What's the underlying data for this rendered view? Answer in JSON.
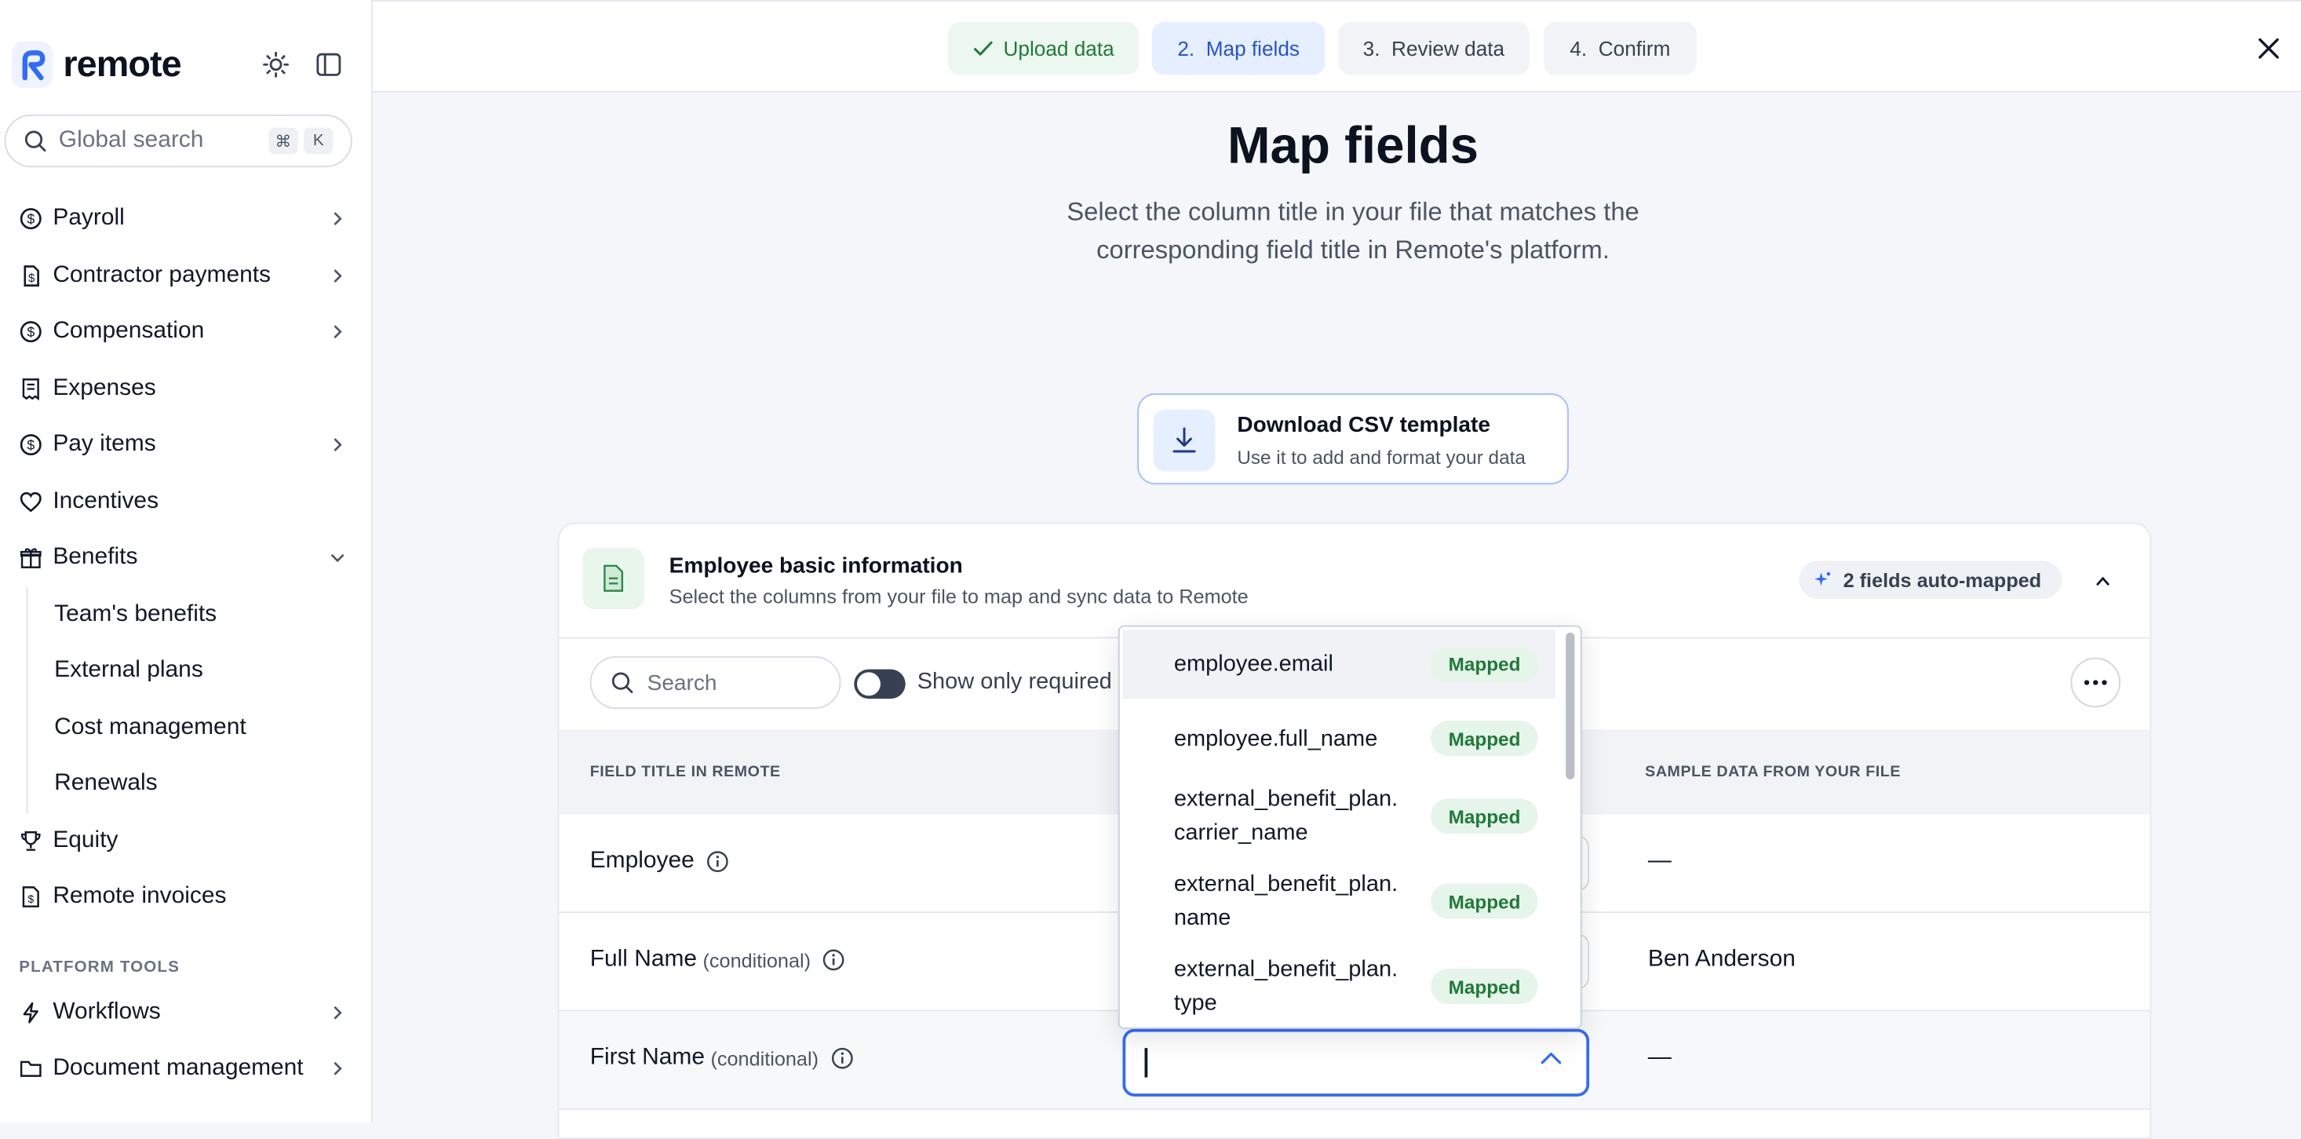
{
  "app": {
    "brand": "remote"
  },
  "sidebar": {
    "search": {
      "placeholder": "Global search",
      "shortcut_1": "⌘",
      "shortcut_2": "K"
    },
    "items": [
      {
        "label": "Payroll",
        "icon": "dollar-circle-icon"
      },
      {
        "label": "Contractor payments",
        "icon": "dollar-doc-icon"
      },
      {
        "label": "Compensation",
        "icon": "dollar-circle-icon"
      },
      {
        "label": "Expenses",
        "icon": "receipt-icon"
      },
      {
        "label": "Pay items",
        "icon": "dollar-circle-icon"
      },
      {
        "label": "Incentives",
        "icon": "heart-icon"
      },
      {
        "label": "Benefits",
        "icon": "gift-icon"
      }
    ],
    "benefits_sub": [
      "Team's benefits",
      "External plans",
      "Cost management",
      "Renewals"
    ],
    "items_after": [
      {
        "label": "Equity",
        "icon": "trophy-icon"
      },
      {
        "label": "Remote invoices",
        "icon": "invoice-icon"
      }
    ],
    "platform_tools_label": "PLATFORM TOOLS",
    "platform_items": [
      {
        "label": "Workflows",
        "icon": "bolt-icon"
      },
      {
        "label": "Document management",
        "icon": "folder-icon"
      }
    ]
  },
  "steps": [
    {
      "label": "Upload data",
      "state": "done"
    },
    {
      "label": "2.  Map fields",
      "state": "active"
    },
    {
      "label": "3.  Review data",
      "state": "todo"
    },
    {
      "label": "4.  Confirm",
      "state": "todo"
    }
  ],
  "page": {
    "title": "Map fields",
    "subtitle": "Select the column title in your file that matches the corresponding field title in Remote's platform."
  },
  "download": {
    "title": "Download CSV template",
    "subtitle": "Use it to add and format your data"
  },
  "section": {
    "title": "Employee basic information",
    "subtitle": "Select the columns from your file to map and sync data to Remote",
    "auto_mapped": "2 fields auto-mapped"
  },
  "toolbar": {
    "search_placeholder": "Search",
    "toggle_label": "Show only required"
  },
  "table": {
    "col_field": "FIELD TITLE IN REMOTE",
    "col_sample": "SAMPLE DATA FROM YOUR FILE",
    "rows": [
      {
        "field": "Employee",
        "qualifier": "",
        "sample": "—"
      },
      {
        "field": "Full Name",
        "qualifier": "(conditional)",
        "sample": "Ben Anderson"
      },
      {
        "field": "First Name",
        "qualifier": "(conditional)",
        "sample": "—"
      }
    ]
  },
  "dropdown": {
    "options": [
      {
        "label": "employee.email",
        "status": "Mapped"
      },
      {
        "label": "employee.full_name",
        "status": "Mapped"
      },
      {
        "label": "external_benefit_plan.\ncarrier_name",
        "status": "Mapped"
      },
      {
        "label": "external_benefit_plan.\nname",
        "status": "Mapped"
      },
      {
        "label": "external_benefit_plan.\ntype",
        "status": "Mapped"
      }
    ]
  },
  "colors": {
    "accent": "#2f6bff",
    "success": "#1f7a3a",
    "brand": "#2452d6"
  }
}
